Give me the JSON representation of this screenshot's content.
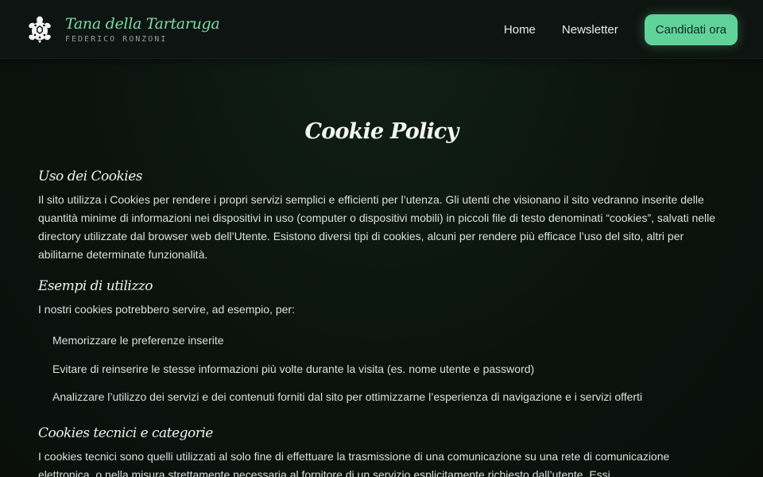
{
  "header": {
    "brand_title": "Tana della Tartaruga",
    "brand_subtitle": "FEDERICO RONZONI",
    "logo_icon": "turtle-icon",
    "nav": [
      {
        "label": "Home"
      },
      {
        "label": "Newsletter"
      }
    ],
    "cta_label": "Candidati ora",
    "accent_color": "#5fd39a"
  },
  "main": {
    "title": "Cookie Policy",
    "sections": [
      {
        "heading": "Uso dei Cookies",
        "text": "Il sito utilizza i Cookies per rendere i propri servizi semplici e efficienti per l’utenza. Gli utenti che visionano il sito vedranno inserite delle quantità minime di informazioni nei dispositivi in uso (computer o dispositivi mobili) in piccoli file di testo denominati “cookies”, salvati nelle directory utilizzate dal browser web dell’Utente. Esistono diversi tipi di cookies, alcuni per rendere più efficace l’uso del sito, altri per abilitarne determinate funzionalità."
      },
      {
        "heading": "Esempi di utilizzo",
        "text": "I nostri cookies potrebbero servire, ad esempio, per:",
        "items": [
          "Memorizzare le preferenze inserite",
          "Evitare di reinserire le stesse informazioni più volte durante la visita (es. nome utente e password)",
          "Analizzare l’utilizzo dei servizi e dei contenuti forniti dal sito per ottimizzarne l’esperienza di navigazione e i servizi offerti"
        ]
      },
      {
        "heading": "Cookies tecnici e categorie",
        "text": "I cookies tecnici sono quelli utilizzati al solo fine di effettuare la trasmissione di una comunicazione su una rete di comunicazione elettronica, o nella misura strettamente necessaria al fornitore di un servizio esplicitamente richiesto dall’utente. Essi"
      }
    ]
  }
}
